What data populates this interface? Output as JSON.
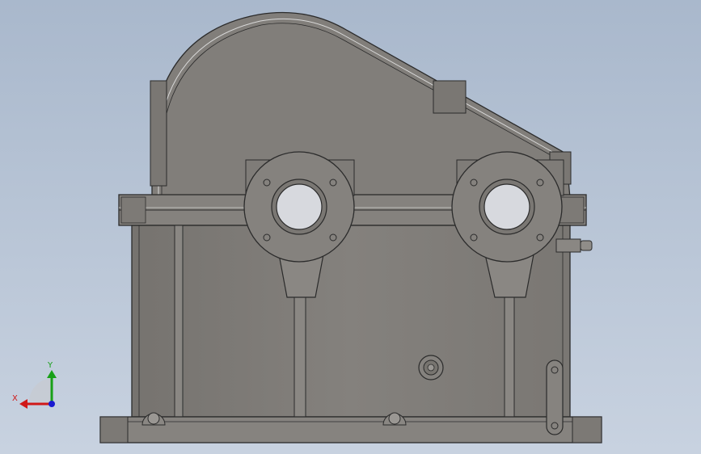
{
  "viewport": {
    "background_top": "#a9b8cc",
    "background_bottom": "#c8d2e0"
  },
  "model": {
    "body_color": "#7f7c78",
    "body_light": "#8d8a86",
    "edge_color": "#2b2b2b",
    "highlight": "#d9d9d9"
  },
  "triad": {
    "x_label": "X",
    "y_label": "Y",
    "x_color": "#d01818",
    "y_color": "#18a018",
    "z_color": "#1a1ad0"
  }
}
